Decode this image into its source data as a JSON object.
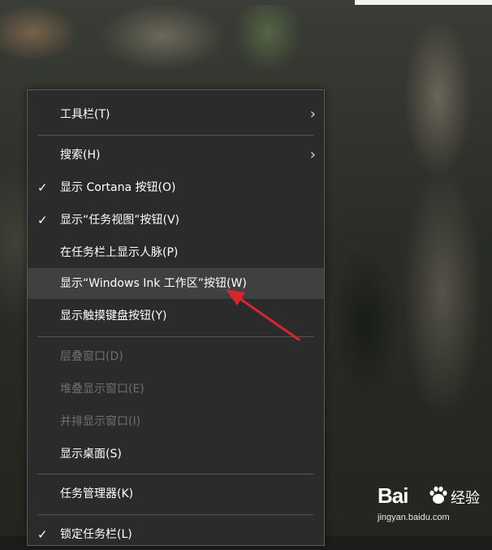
{
  "menu": {
    "items": [
      {
        "label": "工具栏(T)",
        "check": "",
        "submenu": "›",
        "disabled": false
      },
      {
        "label": "搜索(H)",
        "check": "",
        "submenu": "›",
        "disabled": false
      },
      {
        "label": "显示 Cortana 按钮(O)",
        "check": "✓",
        "submenu": "",
        "disabled": false
      },
      {
        "label": "显示“任务视图”按钮(V)",
        "check": "✓",
        "submenu": "",
        "disabled": false
      },
      {
        "label": "在任务栏上显示人脉(P)",
        "check": "",
        "submenu": "",
        "disabled": false
      },
      {
        "label": "显示“Windows Ink 工作区”按钮(W)",
        "check": "",
        "submenu": "",
        "disabled": false
      },
      {
        "label": "显示触摸键盘按钮(Y)",
        "check": "",
        "submenu": "",
        "disabled": false
      },
      {
        "label": "层叠窗口(D)",
        "check": "",
        "submenu": "",
        "disabled": true
      },
      {
        "label": "堆叠显示窗口(E)",
        "check": "",
        "submenu": "",
        "disabled": true
      },
      {
        "label": "并排显示窗口(I)",
        "check": "",
        "submenu": "",
        "disabled": true
      },
      {
        "label": "显示桌面(S)",
        "check": "",
        "submenu": "",
        "disabled": false
      },
      {
        "label": "任务管理器(K)",
        "check": "",
        "submenu": "",
        "disabled": false
      },
      {
        "label": "锁定任务栏(L)",
        "check": "✓",
        "submenu": "",
        "disabled": false
      }
    ]
  },
  "annotation": {
    "arrow_color": "#d9262c"
  },
  "watermark": {
    "brand": "Bai",
    "brand2": "经验",
    "url": "jingyan.baidu.com"
  }
}
